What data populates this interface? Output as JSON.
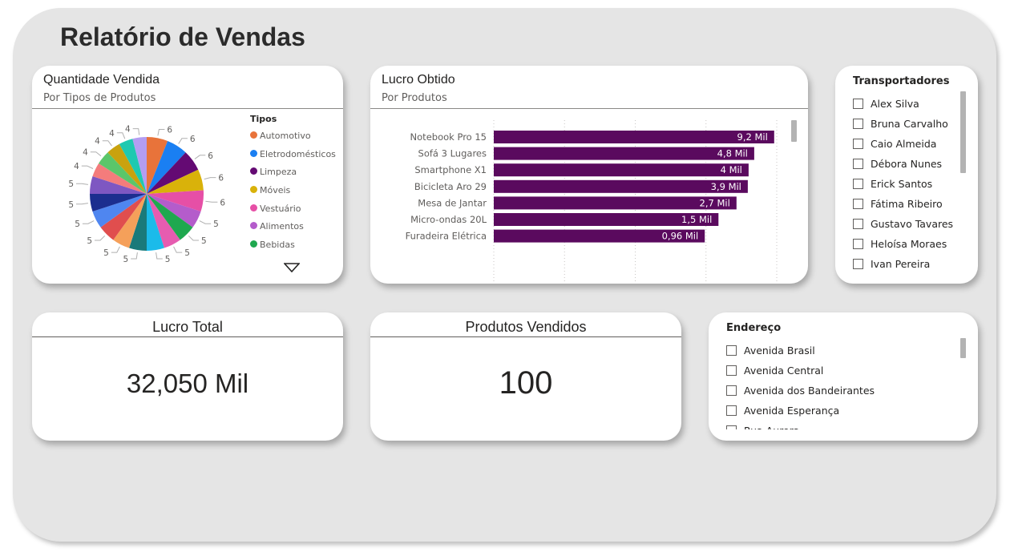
{
  "report_title": "Relatório de Vendas",
  "pie_card": {
    "title": "Quantidade Vendida",
    "subtitle": "Por Tipos de Produtos",
    "legend_title": "Tipos",
    "legend": [
      {
        "label": "Automotivo",
        "color": "#E8733A"
      },
      {
        "label": "Eletrodomésticos",
        "color": "#1A7FF2"
      },
      {
        "label": "Limpeza",
        "color": "#640A73"
      },
      {
        "label": "Móveis",
        "color": "#D9B20A"
      },
      {
        "label": "Vestuário",
        "color": "#E64FA6"
      },
      {
        "label": "Alimentos",
        "color": "#B45CCB"
      },
      {
        "label": "Bebidas",
        "color": "#1FA84F"
      }
    ],
    "more_icon": "caret-down-icon"
  },
  "bar_card": {
    "title": "Lucro Obtido",
    "subtitle": "Por Produtos"
  },
  "chart_data": [
    {
      "type": "pie",
      "slices": [
        {
          "value": 6,
          "color": "#E8733A"
        },
        {
          "value": 6,
          "color": "#1A7FF2"
        },
        {
          "value": 6,
          "color": "#640A73"
        },
        {
          "value": 6,
          "color": "#D9B20A"
        },
        {
          "value": 6,
          "color": "#E64FA6"
        },
        {
          "value": 5,
          "color": "#B45CCB"
        },
        {
          "value": 5,
          "color": "#1FA84F"
        },
        {
          "value": 5,
          "color": "#E65CB0"
        },
        {
          "value": 5,
          "color": "#1BBBEA"
        },
        {
          "value": 5,
          "color": "#1A7A7A"
        },
        {
          "value": 5,
          "color": "#F5A05A"
        },
        {
          "value": 5,
          "color": "#E04E4E"
        },
        {
          "value": 5,
          "color": "#4F86F0"
        },
        {
          "value": 5,
          "color": "#1C2E8F"
        },
        {
          "value": 5,
          "color": "#7E57C2"
        },
        {
          "value": 4,
          "color": "#F47C7C"
        },
        {
          "value": 4,
          "color": "#5BC66A"
        },
        {
          "value": 4,
          "color": "#C9A20E"
        },
        {
          "value": 4,
          "color": "#1FC9B0"
        },
        {
          "value": 4,
          "color": "#B39DF2"
        }
      ]
    },
    {
      "type": "bar",
      "orientation": "horizontal",
      "x_scale": "log",
      "xlim": [
        1,
        10000
      ],
      "x_ticks": [
        "1",
        "10",
        "100",
        "1.000",
        "10.000"
      ],
      "x_tick_values": [
        1,
        10,
        100,
        1000,
        10000
      ],
      "categories": [
        "Notebook Pro 15",
        "Sofá 3 Lugares",
        "Smartphone X1",
        "Bicicleta Aro 29",
        "Mesa de Jantar",
        "Micro-ondas 20L",
        "Furadeira Elétrica"
      ],
      "values": [
        9200,
        4800,
        4000,
        3900,
        2700,
        1500,
        960
      ],
      "data_labels": [
        "9,2 Mil",
        "4,8 Mil",
        "4 Mil",
        "3,9 Mil",
        "2,7 Mil",
        "1,5 Mil",
        "0,96 Mil"
      ],
      "bar_color": "#5A0A5E"
    }
  ],
  "kpi_profit": {
    "title": "Lucro Total",
    "value": "32,050 Mil"
  },
  "kpi_products": {
    "title": "Produtos Vendidos",
    "value": "100"
  },
  "slicer_carriers": {
    "title": "Transportadores",
    "items": [
      "Alex Silva",
      "Bruna Carvalho",
      "Caio Almeida",
      "Débora Nunes",
      "Erick Santos",
      "Fátima Ribeiro",
      "Gustavo Tavares",
      "Heloísa Moraes",
      "Ivan Pereira"
    ]
  },
  "slicer_address": {
    "title": "Endereço",
    "items": [
      "Avenida Brasil",
      "Avenida Central",
      "Avenida dos Bandeirantes",
      "Avenida Esperança",
      "Rua Aurora"
    ]
  }
}
